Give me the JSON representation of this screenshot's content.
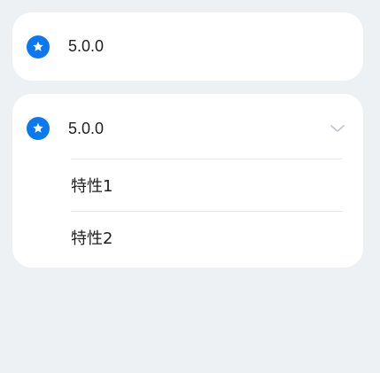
{
  "cards": [
    {
      "title": "5.0.0",
      "icon": "star-badge-icon"
    },
    {
      "title": "5.0.0",
      "icon": "star-badge-icon",
      "expand_icon": "chevron-down-icon",
      "items": [
        {
          "label": "特性1"
        },
        {
          "label": "特性2"
        }
      ]
    }
  ],
  "colors": {
    "background": "#eef1f4",
    "card": "#ffffff",
    "accent": "#0b78f0",
    "text": "#1f1f1f",
    "divider": "#e6e8eb",
    "chevron": "#bfc4ca"
  }
}
